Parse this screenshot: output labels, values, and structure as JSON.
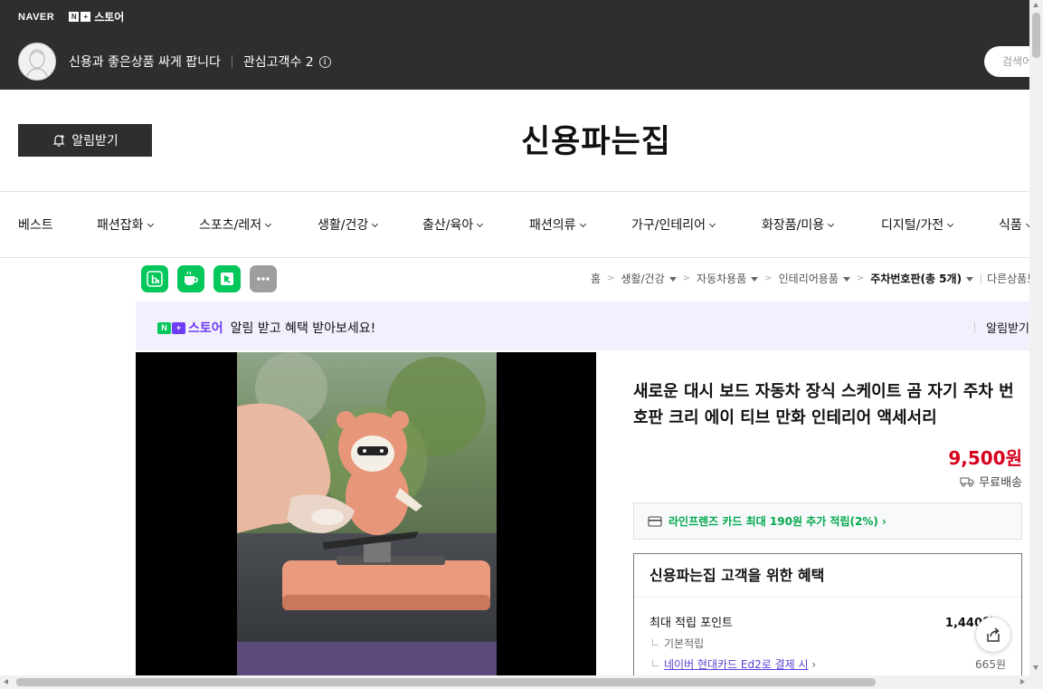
{
  "header": {
    "naver": "NAVER",
    "nplus_badge": "N+",
    "nplus_store": "스토어",
    "seller_name": "신용과 좋은상품 싸게 팝니다",
    "fav_label": "관심고객수 2",
    "info": "i",
    "search_placeholder": "검색어"
  },
  "store": {
    "alarm_button": "알림받기",
    "title": "신용파는집"
  },
  "categories": [
    {
      "label": "베스트",
      "dropdown": false
    },
    {
      "label": "패션잡화",
      "dropdown": true
    },
    {
      "label": "스포츠/레저",
      "dropdown": true
    },
    {
      "label": "생활/건강",
      "dropdown": true
    },
    {
      "label": "출산/육아",
      "dropdown": true
    },
    {
      "label": "패션의류",
      "dropdown": true
    },
    {
      "label": "가구/인테리어",
      "dropdown": true
    },
    {
      "label": "화장품/미용",
      "dropdown": true
    },
    {
      "label": "디지털/가전",
      "dropdown": true
    },
    {
      "label": "식품",
      "dropdown": true
    }
  ],
  "share_icons": [
    "blog-icon",
    "cafe-icon",
    "band-icon",
    "more-icon"
  ],
  "breadcrumb": {
    "home": "홈",
    "items": [
      "생활/건강",
      "자동차용품",
      "인테리어용품"
    ],
    "current": "주차번호판(총 5개)",
    "other": "다른상품보기"
  },
  "banner": {
    "badge": "N+",
    "store": "스토어",
    "text": "알림 받고 혜택 받아보세요!",
    "action": "알림받기"
  },
  "product": {
    "title": "새로운 대시 보드 자동차 장식 스케이트 곰 자기 주차 번호판 크리 에이 티브 만화 인테리어 액세서리",
    "price": "9,500원",
    "shipping": "무료배송",
    "card_offer": "라인프렌즈 카드 최대 190원 추가 적립(2%)"
  },
  "benefit": {
    "title": "신용파는집 고객을 위한 혜택",
    "max_point_label": "최대 적립 포인트",
    "max_point_value": "1,440원",
    "basic_label": "기본적립",
    "card_link": "네이버 현대카드 Ed2로 결제 시",
    "card_value": "665원"
  },
  "colors": {
    "header_bg": "#2e2e2e",
    "price_red": "#d6001c",
    "naver_green": "#03c75a",
    "store_purple": "#6e3cf4",
    "banner_bg": "#f3f0fd"
  }
}
